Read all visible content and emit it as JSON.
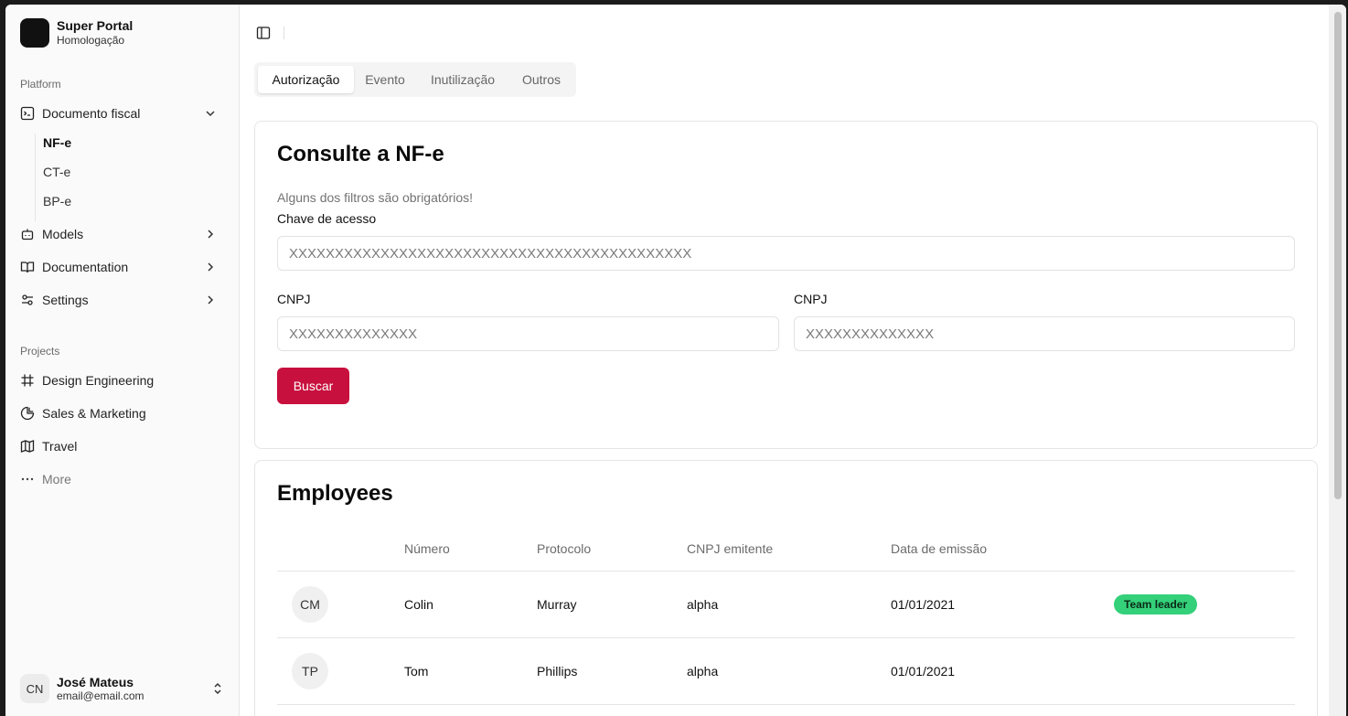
{
  "sidebar": {
    "brand": {
      "name": "Super Portal",
      "subtitle": "Homologação"
    },
    "platform_label": "Platform",
    "platform_items": [
      {
        "label": "Documento fiscal",
        "icon": "terminal-square-icon",
        "expanded": true
      },
      {
        "label": "Models",
        "icon": "bot-icon"
      },
      {
        "label": "Documentation",
        "icon": "book-open-icon"
      },
      {
        "label": "Settings",
        "icon": "settings-sliders-icon"
      }
    ],
    "sub_items": [
      {
        "label": "NF-e",
        "active": true
      },
      {
        "label": "CT-e"
      },
      {
        "label": "BP-e"
      }
    ],
    "projects_label": "Projects",
    "projects": [
      {
        "label": "Design Engineering",
        "icon": "frame-icon"
      },
      {
        "label": "Sales & Marketing",
        "icon": "pie-chart-icon"
      },
      {
        "label": "Travel",
        "icon": "map-icon"
      },
      {
        "label": "More",
        "icon": "more-horizontal-icon"
      }
    ],
    "user": {
      "initials": "CN",
      "name": "José Mateus",
      "email": "email@email.com"
    }
  },
  "tabs": [
    {
      "label": "Autorização",
      "active": true
    },
    {
      "label": "Evento"
    },
    {
      "label": "Inutilização"
    },
    {
      "label": "Outros"
    }
  ],
  "search_card": {
    "title": "Consulte a NF-e",
    "hint": "Alguns dos filtros são obrigatórios!",
    "access_key": {
      "label": "Chave de acesso",
      "placeholder": "XXXXXXXXXXXXXXXXXXXXXXXXXXXXXXXXXXXXXXXXXXXX"
    },
    "cnpj_left": {
      "label": "CNPJ",
      "placeholder": "XXXXXXXXXXXXXX"
    },
    "cnpj_right": {
      "label": "CNPJ",
      "placeholder": "XXXXXXXXXXXXXX"
    },
    "submit_label": "Buscar"
  },
  "employees": {
    "title": "Employees",
    "columns": [
      "Número",
      "Protocolo",
      "CNPJ emitente",
      "Data de emissão"
    ],
    "rows": [
      {
        "initials": "CM",
        "numero": "Colin",
        "protocolo": "Murray",
        "cnpj": "alpha",
        "data": "01/01/2021",
        "badge": "Team leader"
      },
      {
        "initials": "TP",
        "numero": "Tom",
        "protocolo": "Phillips",
        "cnpj": "alpha",
        "data": "01/01/2021",
        "badge": ""
      }
    ]
  },
  "colors": {
    "accent": "#c8103e",
    "badge": "#34d07a"
  }
}
